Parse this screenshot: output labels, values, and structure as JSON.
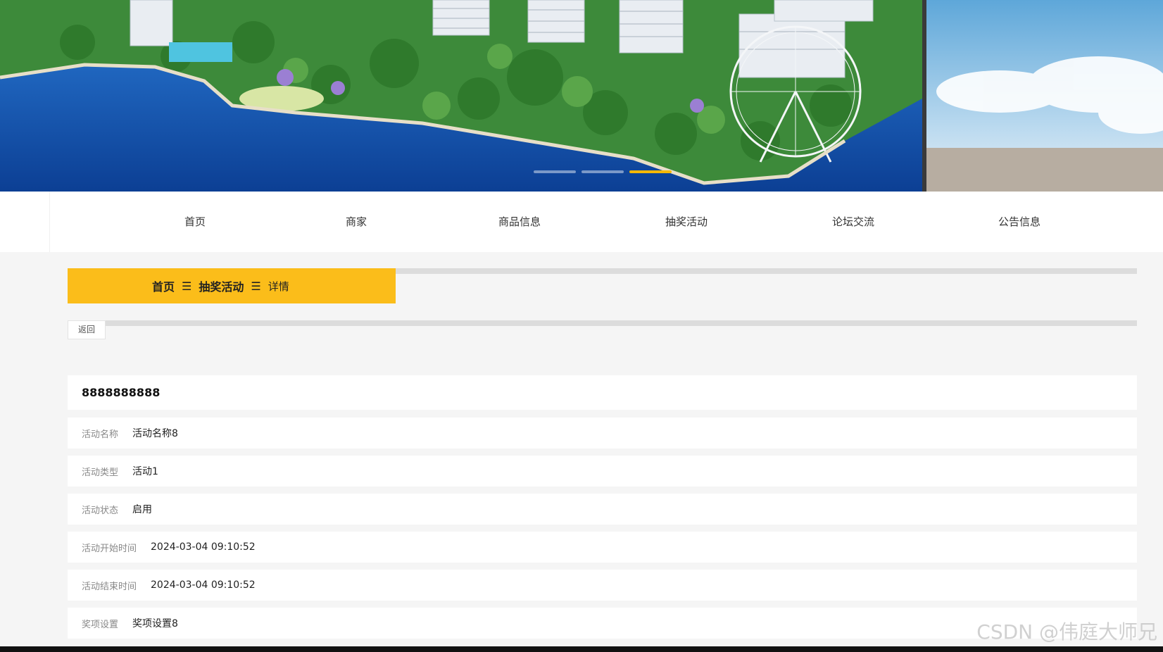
{
  "nav": {
    "items": [
      {
        "label": "首页"
      },
      {
        "label": "商家"
      },
      {
        "label": "商品信息"
      },
      {
        "label": "抽奖活动"
      },
      {
        "label": "论坛交流"
      },
      {
        "label": "公告信息"
      }
    ]
  },
  "breadcrumb": {
    "home": "首页",
    "section": "抽奖活动",
    "current": "详情",
    "separator": "☰"
  },
  "back_label": "返回",
  "detail": {
    "title": "8888888888",
    "fields": [
      {
        "label": "活动名称",
        "value": "活动名称8"
      },
      {
        "label": "活动类型",
        "value": "活动1"
      },
      {
        "label": "活动状态",
        "value": "启用"
      },
      {
        "label": "活动开始时间",
        "value": "2024-03-04 09:10:52"
      },
      {
        "label": "活动结束时间",
        "value": "2024-03-04 09:10:52"
      },
      {
        "label": "奖项设置",
        "value": "奖项设置8"
      }
    ]
  },
  "watermark": "CSDN @伟庭大师兄",
  "colors": {
    "accent": "#fbbd1a",
    "page_bg": "#f5f5f5"
  },
  "carousel": {
    "slide_count": 3,
    "active_index": 2
  }
}
